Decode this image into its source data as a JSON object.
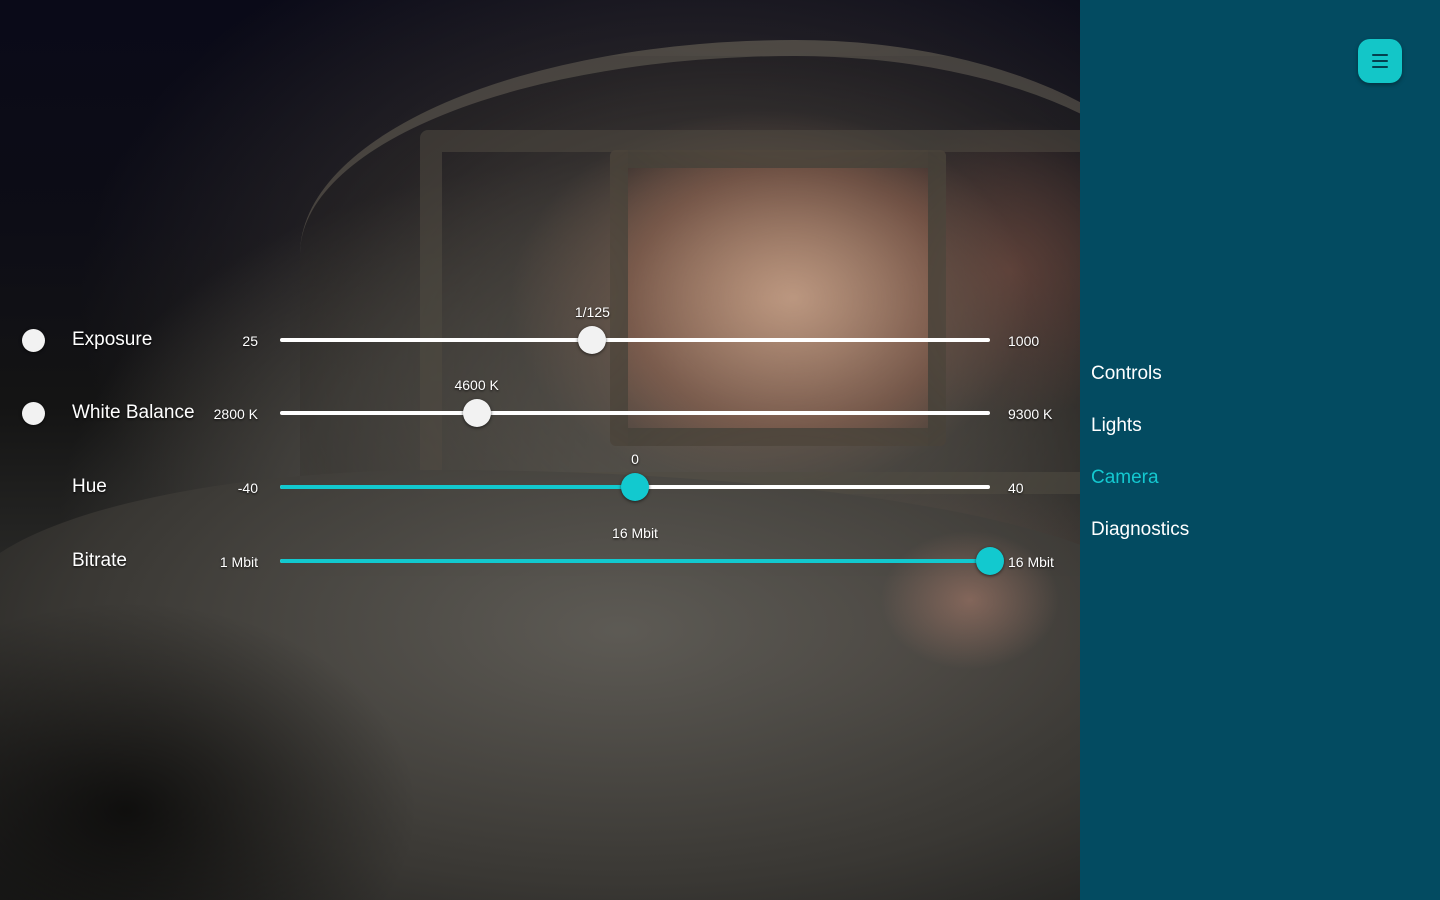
{
  "theme": {
    "accent": "#12c9cf",
    "sidebar_bg": "#034b61",
    "track": "#ffffff"
  },
  "controls": [
    {
      "id": "exposure",
      "label": "Exposure",
      "has_toggle": true,
      "min_label": "25",
      "max_label": "1000",
      "value_label": "1/125",
      "position": 0.44,
      "accent": false
    },
    {
      "id": "white-balance",
      "label": "White Balance",
      "has_toggle": true,
      "min_label": "2800 K",
      "max_label": "9300 K",
      "value_label": "4600 K",
      "position": 0.277,
      "accent": false
    },
    {
      "id": "hue",
      "label": "Hue",
      "has_toggle": false,
      "min_label": "-40",
      "max_label": "40",
      "value_label": "0",
      "position": 0.5,
      "accent": true
    },
    {
      "id": "bitrate",
      "label": "Bitrate",
      "has_toggle": false,
      "min_label": "1 Mbit",
      "max_label": "16 Mbit",
      "value_label": "16 Mbit",
      "position": 1.0,
      "accent": true
    }
  ],
  "sidebar": {
    "menu_icon": "hamburger-menu-icon",
    "items": [
      {
        "label": "Controls",
        "active": false
      },
      {
        "label": "Lights",
        "active": false
      },
      {
        "label": "Camera",
        "active": true
      },
      {
        "label": "Diagnostics",
        "active": false
      }
    ]
  }
}
